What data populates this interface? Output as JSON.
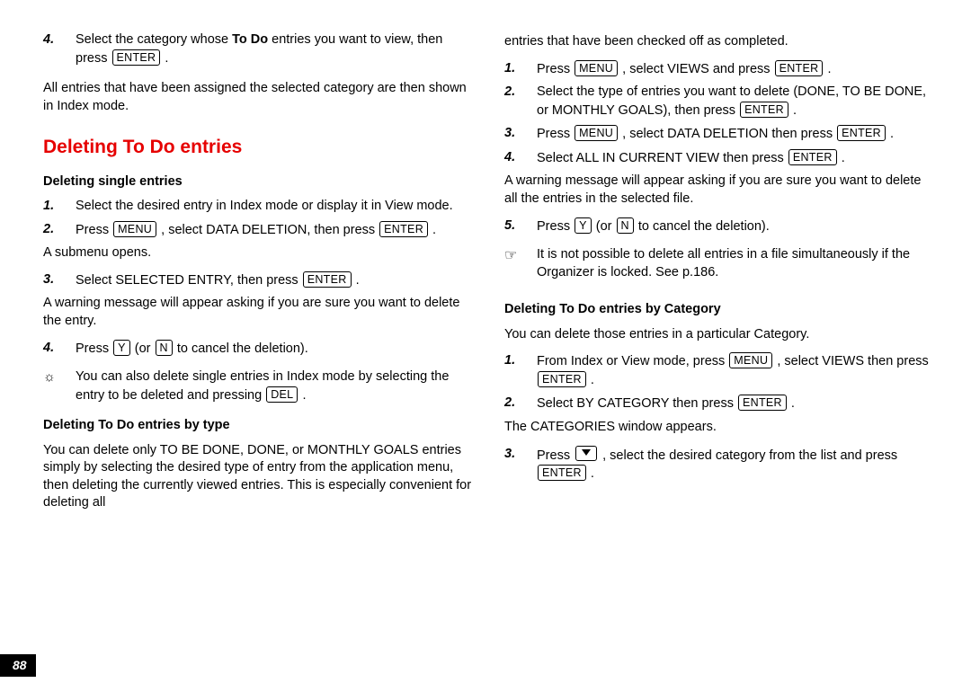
{
  "page_number": "88",
  "keys": {
    "enter": "ENTER",
    "menu": "MENU",
    "y": "Y",
    "n": "N",
    "del": "DEL"
  },
  "symbols": {
    "bulb": "☼",
    "hand": "☞"
  },
  "left": {
    "step4_a": "Select the category whose ",
    "step4_bold": "To Do",
    "step4_b": " entries you want to view, then press ",
    "after1": "All entries that have been assigned the selected category are then shown in Index mode.",
    "h_red": "Deleting To Do entries",
    "h_single": "Deleting single entries",
    "s1": "Select the desired entry in Index mode or display it in View mode.",
    "s2_a": "Press ",
    "s2_b": " , select DATA DELETION, then press ",
    "s2_c": " .",
    "sub_opens": "A submenu opens.",
    "s3_a": "Select SELECTED ENTRY, then press ",
    "s3_b": " .",
    "warn": "A warning message will appear asking if you are sure you want to delete the entry.",
    "s4_a": "Press ",
    "s4_b": "  (or ",
    "s4_c": "  to cancel the deletion).",
    "tip_a": "You can also delete single entries in Index mode by selecting the entry to be deleted and pressing ",
    "tip_b": " .",
    "h_type": "Deleting To Do entries by type",
    "type_para": "You can delete only TO BE DONE, DONE, or MONTHLY GOALS entries simply by selecting the desired type of entry from the application menu, then deleting the currently viewed entries. This is especially convenient for deleting all"
  },
  "right": {
    "cont": "entries that have been checked off as completed.",
    "r1_a": "Press ",
    "r1_b": " , select VIEWS and press ",
    "r1_c": " .",
    "r2_a": "Select the type of entries you want to delete (DONE, TO BE DONE, or MONTHLY GOALS), then press ",
    "r2_b": " .",
    "r3_a": "Press ",
    "r3_b": " , select DATA DELETION then press ",
    "r3_c": " .",
    "r4_a": "Select ALL IN CURRENT VIEW then press ",
    "r4_b": " .",
    "warn2": "A warning message will appear asking if you are sure you want to delete all the entries in the selected file.",
    "r5_a": "Press ",
    "r5_b": "  (or ",
    "r5_c": "  to cancel the deletion).",
    "hand_tip": "It is not possible to delete all entries in a file simultaneously if the Organizer is locked. See p.186.",
    "h_cat": "Deleting To Do entries by Category",
    "cat_intro": "You can delete those entries in a particular Category.",
    "c1_a": "From Index or View mode, press ",
    "c1_b": " , select VIEWS then press ",
    "c1_c": " .",
    "c2_a": "Select BY CATEGORY then press ",
    "c2_b": " .",
    "cat_win": "The CATEGORIES window appears.",
    "c3_a": "Press ",
    "c3_b": " , select the desired category from the list and press ",
    "c3_c": " ."
  },
  "nums": {
    "n1": "1.",
    "n2": "2.",
    "n3": "3.",
    "n4": "4.",
    "n5": "5."
  }
}
